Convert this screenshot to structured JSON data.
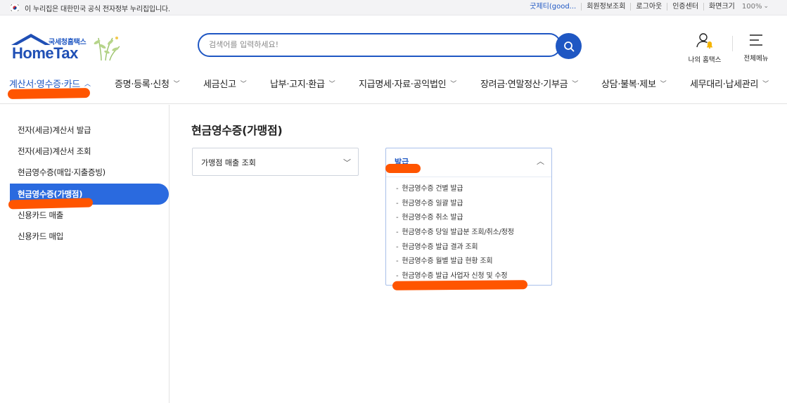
{
  "govbar": {
    "text": "이 누리집은 대한민국 공식 전자정부 누리집입니다.",
    "user": "굿제티(good...",
    "links": [
      "회원정보조회",
      "로그아웃",
      "인증센터"
    ],
    "zoom_label": "화면크기",
    "zoom_value": "100%"
  },
  "header": {
    "brand_sub": "국세청홈택스",
    "brand": "HomeTax",
    "search_placeholder": "검색어를 입력하세요!",
    "my_hometax": "나의 홈택스",
    "all_menu": "전체메뉴"
  },
  "nav": [
    "계산서·영수증·카드",
    "증명·등록·신청",
    "세금신고",
    "납부·고지·환급",
    "지급명세·자료·공익법인",
    "장려금·연말정산·기부금",
    "상담·불복·제보",
    "세무대리·납세관리"
  ],
  "sidebar": [
    "전자(세금)계산서 발급",
    "전자(세금)계산서 조회",
    "현금영수증(매입·지출증빙)",
    "현금영수증(가맹점)",
    "신용카드 매출",
    "신용카드 매입"
  ],
  "content": {
    "title": "현금영수증(가맹점)",
    "left_box": "가맹점 매출 조회",
    "right_box": {
      "title": "발급",
      "items": [
        "현금영수증 건별 발급",
        "현금영수증 일괄 발급",
        "현금영수증 취소 발급",
        "현금영수증 당일 발급분 조회/취소/정정",
        "현금영수증 발급 결과 조회",
        "현금영수증 월별 발급 현황 조회",
        "현금영수증 발급 사업자 신청 및 수정"
      ]
    }
  },
  "colors": {
    "brand_blue": "#1f57c3",
    "active_blue": "#2a6adf",
    "highlight": "#ff5500"
  }
}
